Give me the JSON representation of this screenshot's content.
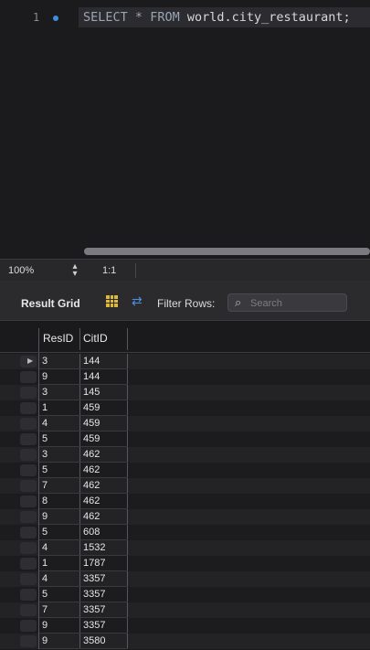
{
  "editor": {
    "line_number": "1",
    "keyword_select": "SELECT",
    "star": "*",
    "keyword_from": "FROM",
    "table_ref": "world.city_restaurant;"
  },
  "statusbar": {
    "zoom": "100%",
    "position": "1:1"
  },
  "toolbar": {
    "result_grid_label": "Result Grid",
    "filter_rows_label": "Filter Rows:",
    "search_placeholder": "Search"
  },
  "grid": {
    "columns": [
      "ResID",
      "CitID"
    ],
    "rows": [
      [
        "3",
        "144"
      ],
      [
        "9",
        "144"
      ],
      [
        "3",
        "145"
      ],
      [
        "1",
        "459"
      ],
      [
        "4",
        "459"
      ],
      [
        "5",
        "459"
      ],
      [
        "3",
        "462"
      ],
      [
        "5",
        "462"
      ],
      [
        "7",
        "462"
      ],
      [
        "8",
        "462"
      ],
      [
        "9",
        "462"
      ],
      [
        "5",
        "608"
      ],
      [
        "4",
        "1532"
      ],
      [
        "1",
        "1787"
      ],
      [
        "4",
        "3357"
      ],
      [
        "5",
        "3357"
      ],
      [
        "7",
        "3357"
      ],
      [
        "9",
        "3357"
      ],
      [
        "9",
        "3580"
      ]
    ]
  },
  "icons": {
    "breakpoint": "breakpoint-dot-icon",
    "zoom": "stepper-icon",
    "grid": "result-grid-icon",
    "refresh": "refresh-arrows-icon",
    "search": "search-icon",
    "row_pointer": "current-row-arrow-icon"
  },
  "colors": {
    "accent": "#3d8fe0",
    "grid_icon": "#e0b93a",
    "background": "#1e1e20"
  }
}
